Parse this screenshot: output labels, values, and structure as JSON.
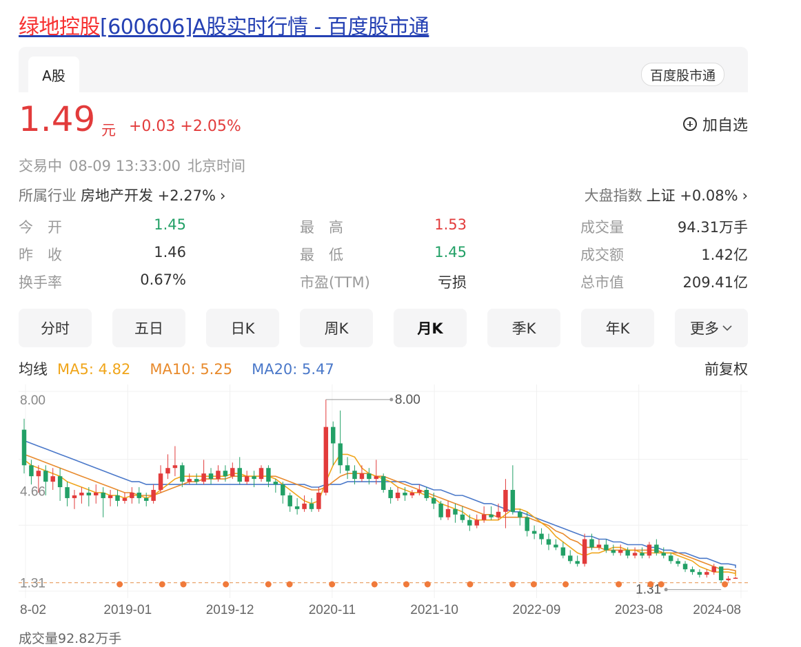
{
  "page_title": {
    "stock_name": "绿地控股",
    "rest": "[600606]A股实时行情 - 百度股市通"
  },
  "tabs": {
    "a_share": "A股",
    "brand": "百度股市通"
  },
  "quote": {
    "price": "1.49",
    "unit": "元",
    "change": "+0.03 +2.05%",
    "add_watch": "加自选",
    "status": "交易中",
    "datetime": "08-09 13:33:00",
    "timezone": "北京时间",
    "industry_label": "所属行业",
    "industry_value": "房地产开发 +2.27%",
    "index_label": "大盘指数",
    "index_value": "上证 +0.08%"
  },
  "stats": [
    [
      {
        "label": "今　开",
        "value": "1.45",
        "trend": "down"
      },
      {
        "label": "最　高",
        "value": "1.53",
        "trend": "up"
      },
      {
        "label": "成交量",
        "value": "94.31万手",
        "trend": ""
      }
    ],
    [
      {
        "label": "昨　收",
        "value": "1.46",
        "trend": ""
      },
      {
        "label": "最　低",
        "value": "1.45",
        "trend": "down"
      },
      {
        "label": "成交额",
        "value": "1.42亿",
        "trend": ""
      }
    ],
    [
      {
        "label": "换手率",
        "value": "0.67%",
        "trend": ""
      },
      {
        "label": "市盈(TTM)",
        "value": "亏损",
        "trend": ""
      },
      {
        "label": "总市值",
        "value": "209.41亿",
        "trend": ""
      }
    ]
  ],
  "period_tabs": [
    "分时",
    "五日",
    "日K",
    "周K",
    "月K",
    "季K",
    "年K",
    "更多"
  ],
  "active_period": "月K",
  "ma": {
    "label": "均线",
    "ma5": "MA5: 4.82",
    "ma10": "MA10: 5.25",
    "ma20": "MA20: 5.47",
    "adjust": "前复权"
  },
  "chart_data": {
    "type": "candlestick",
    "y_ticks": [
      "8.00",
      "4.66",
      "1.31"
    ],
    "x_ticks": [
      "8-02",
      "2019-01",
      "2019-12",
      "2020-11",
      "2021-10",
      "2022-09",
      "2023-08",
      "2024-08"
    ],
    "max_label": "8.00",
    "min_label": "1.31",
    "reference_line": 1.31,
    "candles": [
      {
        "o": 6.9,
        "c": 5.6,
        "h": 7.3,
        "l": 5.3
      },
      {
        "o": 5.6,
        "c": 5.2,
        "h": 5.8,
        "l": 4.9
      },
      {
        "o": 5.2,
        "c": 5.4,
        "h": 5.6,
        "l": 4.6
      },
      {
        "o": 5.4,
        "c": 5.0,
        "h": 5.6,
        "l": 4.5
      },
      {
        "o": 5.0,
        "c": 5.2,
        "h": 5.5,
        "l": 4.7
      },
      {
        "o": 5.2,
        "c": 4.8,
        "h": 5.5,
        "l": 4.3
      },
      {
        "o": 4.8,
        "c": 4.4,
        "h": 5.0,
        "l": 4.1
      },
      {
        "o": 4.4,
        "c": 4.5,
        "h": 4.7,
        "l": 4.0
      },
      {
        "o": 4.5,
        "c": 4.6,
        "h": 4.8,
        "l": 4.2
      },
      {
        "o": 4.6,
        "c": 4.5,
        "h": 4.8,
        "l": 4.1
      },
      {
        "o": 4.5,
        "c": 4.6,
        "h": 4.9,
        "l": 4.2
      },
      {
        "o": 4.6,
        "c": 4.4,
        "h": 4.8,
        "l": 3.7
      },
      {
        "o": 4.4,
        "c": 4.5,
        "h": 4.7,
        "l": 4.1
      },
      {
        "o": 4.5,
        "c": 4.3,
        "h": 4.7,
        "l": 4.1
      },
      {
        "o": 4.3,
        "c": 4.4,
        "h": 4.6,
        "l": 4.2
      },
      {
        "o": 4.4,
        "c": 4.6,
        "h": 4.8,
        "l": 4.2
      },
      {
        "o": 4.6,
        "c": 4.4,
        "h": 4.8,
        "l": 4.2
      },
      {
        "o": 4.4,
        "c": 4.3,
        "h": 4.6,
        "l": 4.1
      },
      {
        "o": 4.3,
        "c": 4.7,
        "h": 4.9,
        "l": 4.2
      },
      {
        "o": 4.7,
        "c": 5.3,
        "h": 5.6,
        "l": 4.6
      },
      {
        "o": 5.3,
        "c": 5.5,
        "h": 6.0,
        "l": 5.1
      },
      {
        "o": 5.5,
        "c": 5.6,
        "h": 6.3,
        "l": 5.2
      },
      {
        "o": 5.6,
        "c": 5.0,
        "h": 5.7,
        "l": 4.8
      },
      {
        "o": 5.0,
        "c": 5.1,
        "h": 5.3,
        "l": 4.9
      },
      {
        "o": 5.1,
        "c": 5.0,
        "h": 5.3,
        "l": 4.9
      },
      {
        "o": 5.0,
        "c": 5.3,
        "h": 5.8,
        "l": 4.9
      },
      {
        "o": 5.3,
        "c": 5.1,
        "h": 5.5,
        "l": 4.9
      },
      {
        "o": 5.1,
        "c": 5.4,
        "h": 5.6,
        "l": 5.0
      },
      {
        "o": 5.4,
        "c": 5.2,
        "h": 5.6,
        "l": 5.0
      },
      {
        "o": 5.2,
        "c": 5.5,
        "h": 5.7,
        "l": 5.1
      },
      {
        "o": 5.5,
        "c": 5.0,
        "h": 5.9,
        "l": 4.9
      },
      {
        "o": 5.0,
        "c": 5.2,
        "h": 5.4,
        "l": 4.9
      },
      {
        "o": 5.2,
        "c": 5.1,
        "h": 5.4,
        "l": 4.8
      },
      {
        "o": 5.1,
        "c": 5.5,
        "h": 5.6,
        "l": 5.0
      },
      {
        "o": 5.5,
        "c": 5.0,
        "h": 5.6,
        "l": 4.8
      },
      {
        "o": 5.0,
        "c": 4.9,
        "h": 5.1,
        "l": 4.6
      },
      {
        "o": 4.9,
        "c": 4.5,
        "h": 5.0,
        "l": 4.2
      },
      {
        "o": 4.5,
        "c": 4.1,
        "h": 4.6,
        "l": 3.9
      },
      {
        "o": 4.1,
        "c": 4.0,
        "h": 4.4,
        "l": 3.8
      },
      {
        "o": 4.0,
        "c": 4.2,
        "h": 4.5,
        "l": 3.9
      },
      {
        "o": 4.2,
        "c": 4.0,
        "h": 4.4,
        "l": 3.9
      },
      {
        "o": 4.0,
        "c": 4.6,
        "h": 4.8,
        "l": 3.9
      },
      {
        "o": 4.6,
        "c": 7.0,
        "h": 8.0,
        "l": 4.5
      },
      {
        "o": 7.0,
        "c": 6.4,
        "h": 7.2,
        "l": 5.6
      },
      {
        "o": 6.4,
        "c": 5.6,
        "h": 7.6,
        "l": 5.3
      },
      {
        "o": 5.6,
        "c": 5.4,
        "h": 5.9,
        "l": 5.1
      },
      {
        "o": 5.4,
        "c": 5.1,
        "h": 5.6,
        "l": 4.9
      },
      {
        "o": 5.1,
        "c": 5.3,
        "h": 5.6,
        "l": 5.0
      },
      {
        "o": 5.3,
        "c": 5.1,
        "h": 5.5,
        "l": 4.9
      },
      {
        "o": 5.1,
        "c": 5.2,
        "h": 5.8,
        "l": 4.9
      },
      {
        "o": 5.2,
        "c": 4.7,
        "h": 5.3,
        "l": 4.6
      },
      {
        "o": 4.7,
        "c": 4.4,
        "h": 4.8,
        "l": 4.2
      },
      {
        "o": 4.4,
        "c": 4.6,
        "h": 4.8,
        "l": 4.3
      },
      {
        "o": 4.6,
        "c": 4.5,
        "h": 4.8,
        "l": 4.3
      },
      {
        "o": 4.5,
        "c": 4.6,
        "h": 4.7,
        "l": 4.4
      },
      {
        "o": 4.6,
        "c": 4.7,
        "h": 4.9,
        "l": 4.5
      },
      {
        "o": 4.7,
        "c": 4.4,
        "h": 4.8,
        "l": 4.3
      },
      {
        "o": 4.4,
        "c": 4.2,
        "h": 4.6,
        "l": 4.0
      },
      {
        "o": 4.2,
        "c": 3.7,
        "h": 4.3,
        "l": 3.6
      },
      {
        "o": 3.7,
        "c": 4.0,
        "h": 4.3,
        "l": 3.6
      },
      {
        "o": 4.0,
        "c": 3.8,
        "h": 4.2,
        "l": 3.5
      },
      {
        "o": 3.8,
        "c": 3.6,
        "h": 4.1,
        "l": 3.5
      },
      {
        "o": 3.6,
        "c": 3.4,
        "h": 3.8,
        "l": 3.2
      },
      {
        "o": 3.4,
        "c": 3.6,
        "h": 3.8,
        "l": 3.3
      },
      {
        "o": 3.6,
        "c": 3.8,
        "h": 4.1,
        "l": 3.5
      },
      {
        "o": 3.8,
        "c": 3.7,
        "h": 4.1,
        "l": 3.6
      },
      {
        "o": 3.7,
        "c": 3.9,
        "h": 4.2,
        "l": 3.6
      },
      {
        "o": 3.9,
        "c": 4.7,
        "h": 5.1,
        "l": 3.3
      },
      {
        "o": 4.7,
        "c": 3.9,
        "h": 5.6,
        "l": 3.8
      },
      {
        "o": 3.9,
        "c": 3.7,
        "h": 4.0,
        "l": 3.4
      },
      {
        "o": 3.7,
        "c": 3.2,
        "h": 3.9,
        "l": 3.0
      },
      {
        "o": 3.2,
        "c": 3.1,
        "h": 3.4,
        "l": 2.9
      },
      {
        "o": 3.1,
        "c": 2.9,
        "h": 3.3,
        "l": 2.7
      },
      {
        "o": 2.9,
        "c": 2.7,
        "h": 3.1,
        "l": 2.5
      },
      {
        "o": 2.7,
        "c": 2.6,
        "h": 2.9,
        "l": 2.5
      },
      {
        "o": 2.6,
        "c": 2.3,
        "h": 2.8,
        "l": 2.2
      },
      {
        "o": 2.3,
        "c": 2.1,
        "h": 2.5,
        "l": 2.0
      },
      {
        "o": 2.1,
        "c": 2.0,
        "h": 2.3,
        "l": 1.9
      },
      {
        "o": 2.0,
        "c": 2.9,
        "h": 3.1,
        "l": 1.9
      },
      {
        "o": 2.9,
        "c": 2.6,
        "h": 3.1,
        "l": 2.5
      },
      {
        "o": 2.6,
        "c": 2.7,
        "h": 2.9,
        "l": 2.5
      },
      {
        "o": 2.7,
        "c": 2.5,
        "h": 2.9,
        "l": 2.4
      },
      {
        "o": 2.5,
        "c": 2.4,
        "h": 2.7,
        "l": 2.3
      },
      {
        "o": 2.4,
        "c": 2.5,
        "h": 2.7,
        "l": 2.3
      },
      {
        "o": 2.5,
        "c": 2.3,
        "h": 2.6,
        "l": 2.2
      },
      {
        "o": 2.3,
        "c": 2.4,
        "h": 2.6,
        "l": 2.2
      },
      {
        "o": 2.4,
        "c": 2.3,
        "h": 2.6,
        "l": 2.2
      },
      {
        "o": 2.3,
        "c": 2.7,
        "h": 2.8,
        "l": 2.2
      },
      {
        "o": 2.7,
        "c": 2.4,
        "h": 2.9,
        "l": 2.3
      },
      {
        "o": 2.4,
        "c": 2.3,
        "h": 2.6,
        "l": 2.2
      },
      {
        "o": 2.3,
        "c": 2.1,
        "h": 2.4,
        "l": 2.0
      },
      {
        "o": 2.1,
        "c": 2.0,
        "h": 2.2,
        "l": 1.9
      },
      {
        "o": 2.0,
        "c": 1.8,
        "h": 2.1,
        "l": 1.7
      },
      {
        "o": 1.8,
        "c": 1.7,
        "h": 1.9,
        "l": 1.6
      },
      {
        "o": 1.7,
        "c": 1.6,
        "h": 1.8,
        "l": 1.5
      },
      {
        "o": 1.6,
        "c": 1.7,
        "h": 1.8,
        "l": 1.5
      },
      {
        "o": 1.7,
        "c": 1.9,
        "h": 2.0,
        "l": 1.6
      },
      {
        "o": 1.9,
        "c": 1.4,
        "h": 1.9,
        "l": 1.31
      },
      {
        "o": 1.4,
        "c": 1.46,
        "h": 1.55,
        "l": 1.35
      },
      {
        "o": 1.46,
        "c": 1.49,
        "h": 1.53,
        "l": 1.45
      }
    ],
    "ma5_values": [
      5.8,
      5.6,
      5.5,
      5.4,
      5.3,
      5.2,
      5.0,
      4.9,
      4.8,
      4.7,
      4.6,
      4.6,
      4.5,
      4.5,
      4.4,
      4.5,
      4.5,
      4.4,
      4.5,
      4.7,
      4.9,
      5.1,
      5.2,
      5.2,
      5.2,
      5.2,
      5.2,
      5.2,
      5.2,
      5.3,
      5.3,
      5.2,
      5.2,
      5.2,
      5.2,
      5.1,
      4.9,
      4.7,
      4.5,
      4.3,
      4.2,
      4.3,
      5.0,
      5.6,
      6.0,
      6.0,
      5.9,
      5.5,
      5.3,
      5.2,
      5.1,
      5.0,
      4.8,
      4.7,
      4.6,
      4.6,
      4.5,
      4.4,
      4.2,
      4.1,
      4.0,
      3.9,
      3.7,
      3.6,
      3.6,
      3.6,
      3.6,
      3.8,
      4.0,
      4.0,
      3.9,
      3.7,
      3.5,
      3.3,
      3.0,
      2.8,
      2.6,
      2.4,
      2.3,
      2.4,
      2.4,
      2.5,
      2.6,
      2.6,
      2.5,
      2.5,
      2.4,
      2.4,
      2.4,
      2.4,
      2.4,
      2.3,
      2.2,
      2.1,
      1.9,
      1.8,
      1.7,
      1.7,
      1.7,
      1.65,
      1.6,
      1.55
    ],
    "ma10_values": [
      6.0,
      5.9,
      5.8,
      5.7,
      5.6,
      5.5,
      5.4,
      5.3,
      5.2,
      5.1,
      5.0,
      4.9,
      4.8,
      4.7,
      4.6,
      4.6,
      4.5,
      4.5,
      4.5,
      4.6,
      4.7,
      4.8,
      4.9,
      5.0,
      5.0,
      5.1,
      5.1,
      5.1,
      5.1,
      5.2,
      5.2,
      5.2,
      5.2,
      5.2,
      5.2,
      5.2,
      5.1,
      5.0,
      4.9,
      4.8,
      4.7,
      4.7,
      4.8,
      5.0,
      5.2,
      5.3,
      5.3,
      5.3,
      5.3,
      5.2,
      5.2,
      5.1,
      5.0,
      4.9,
      4.8,
      4.7,
      4.6,
      4.5,
      4.4,
      4.3,
      4.2,
      4.1,
      4.0,
      3.9,
      3.8,
      3.8,
      3.7,
      3.7,
      3.7,
      3.7,
      3.7,
      3.6,
      3.5,
      3.4,
      3.2,
      3.1,
      2.9,
      2.8,
      2.6,
      2.6,
      2.6,
      2.5,
      2.5,
      2.5,
      2.5,
      2.5,
      2.5,
      2.5,
      2.5,
      2.4,
      2.4,
      2.4,
      2.3,
      2.2,
      2.1,
      2.0,
      1.9,
      1.8,
      1.8,
      1.75,
      1.7,
      1.65
    ],
    "ma20_values": [
      6.5,
      6.4,
      6.3,
      6.2,
      6.1,
      6.0,
      5.9,
      5.8,
      5.7,
      5.6,
      5.5,
      5.4,
      5.3,
      5.2,
      5.1,
      5.0,
      5.0,
      4.9,
      4.9,
      4.9,
      4.9,
      4.9,
      4.9,
      4.9,
      4.9,
      4.9,
      4.9,
      4.9,
      4.9,
      4.9,
      4.9,
      4.9,
      4.9,
      4.9,
      4.9,
      4.9,
      4.9,
      4.9,
      4.9,
      4.9,
      4.8,
      4.8,
      4.9,
      4.9,
      4.9,
      5.0,
      5.0,
      5.0,
      5.0,
      5.0,
      5.0,
      5.0,
      5.0,
      5.0,
      4.9,
      4.9,
      4.8,
      4.7,
      4.7,
      4.6,
      4.5,
      4.5,
      4.4,
      4.3,
      4.2,
      4.2,
      4.1,
      4.0,
      3.9,
      3.9,
      3.8,
      3.7,
      3.6,
      3.5,
      3.4,
      3.3,
      3.2,
      3.1,
      3.0,
      3.0,
      2.9,
      2.9,
      2.8,
      2.8,
      2.7,
      2.7,
      2.7,
      2.6,
      2.6,
      2.5,
      2.5,
      2.4,
      2.4,
      2.3,
      2.2,
      2.2,
      2.1,
      2.0,
      2.0,
      1.95,
      1.9,
      1.85
    ],
    "event_dot_indices": [
      9,
      13,
      15,
      19,
      23,
      25,
      29,
      33,
      36,
      38,
      42,
      46,
      48,
      51,
      56,
      59,
      60,
      66
    ]
  },
  "volume_label": "成交量92.82万手",
  "colors": {
    "up": "#e23b3b",
    "down": "#22a066",
    "ma5": "#f0a51a",
    "ma10": "#e88a2c",
    "ma20": "#4a78c9",
    "link": "#2440b3",
    "dot": "#f07a3a"
  }
}
